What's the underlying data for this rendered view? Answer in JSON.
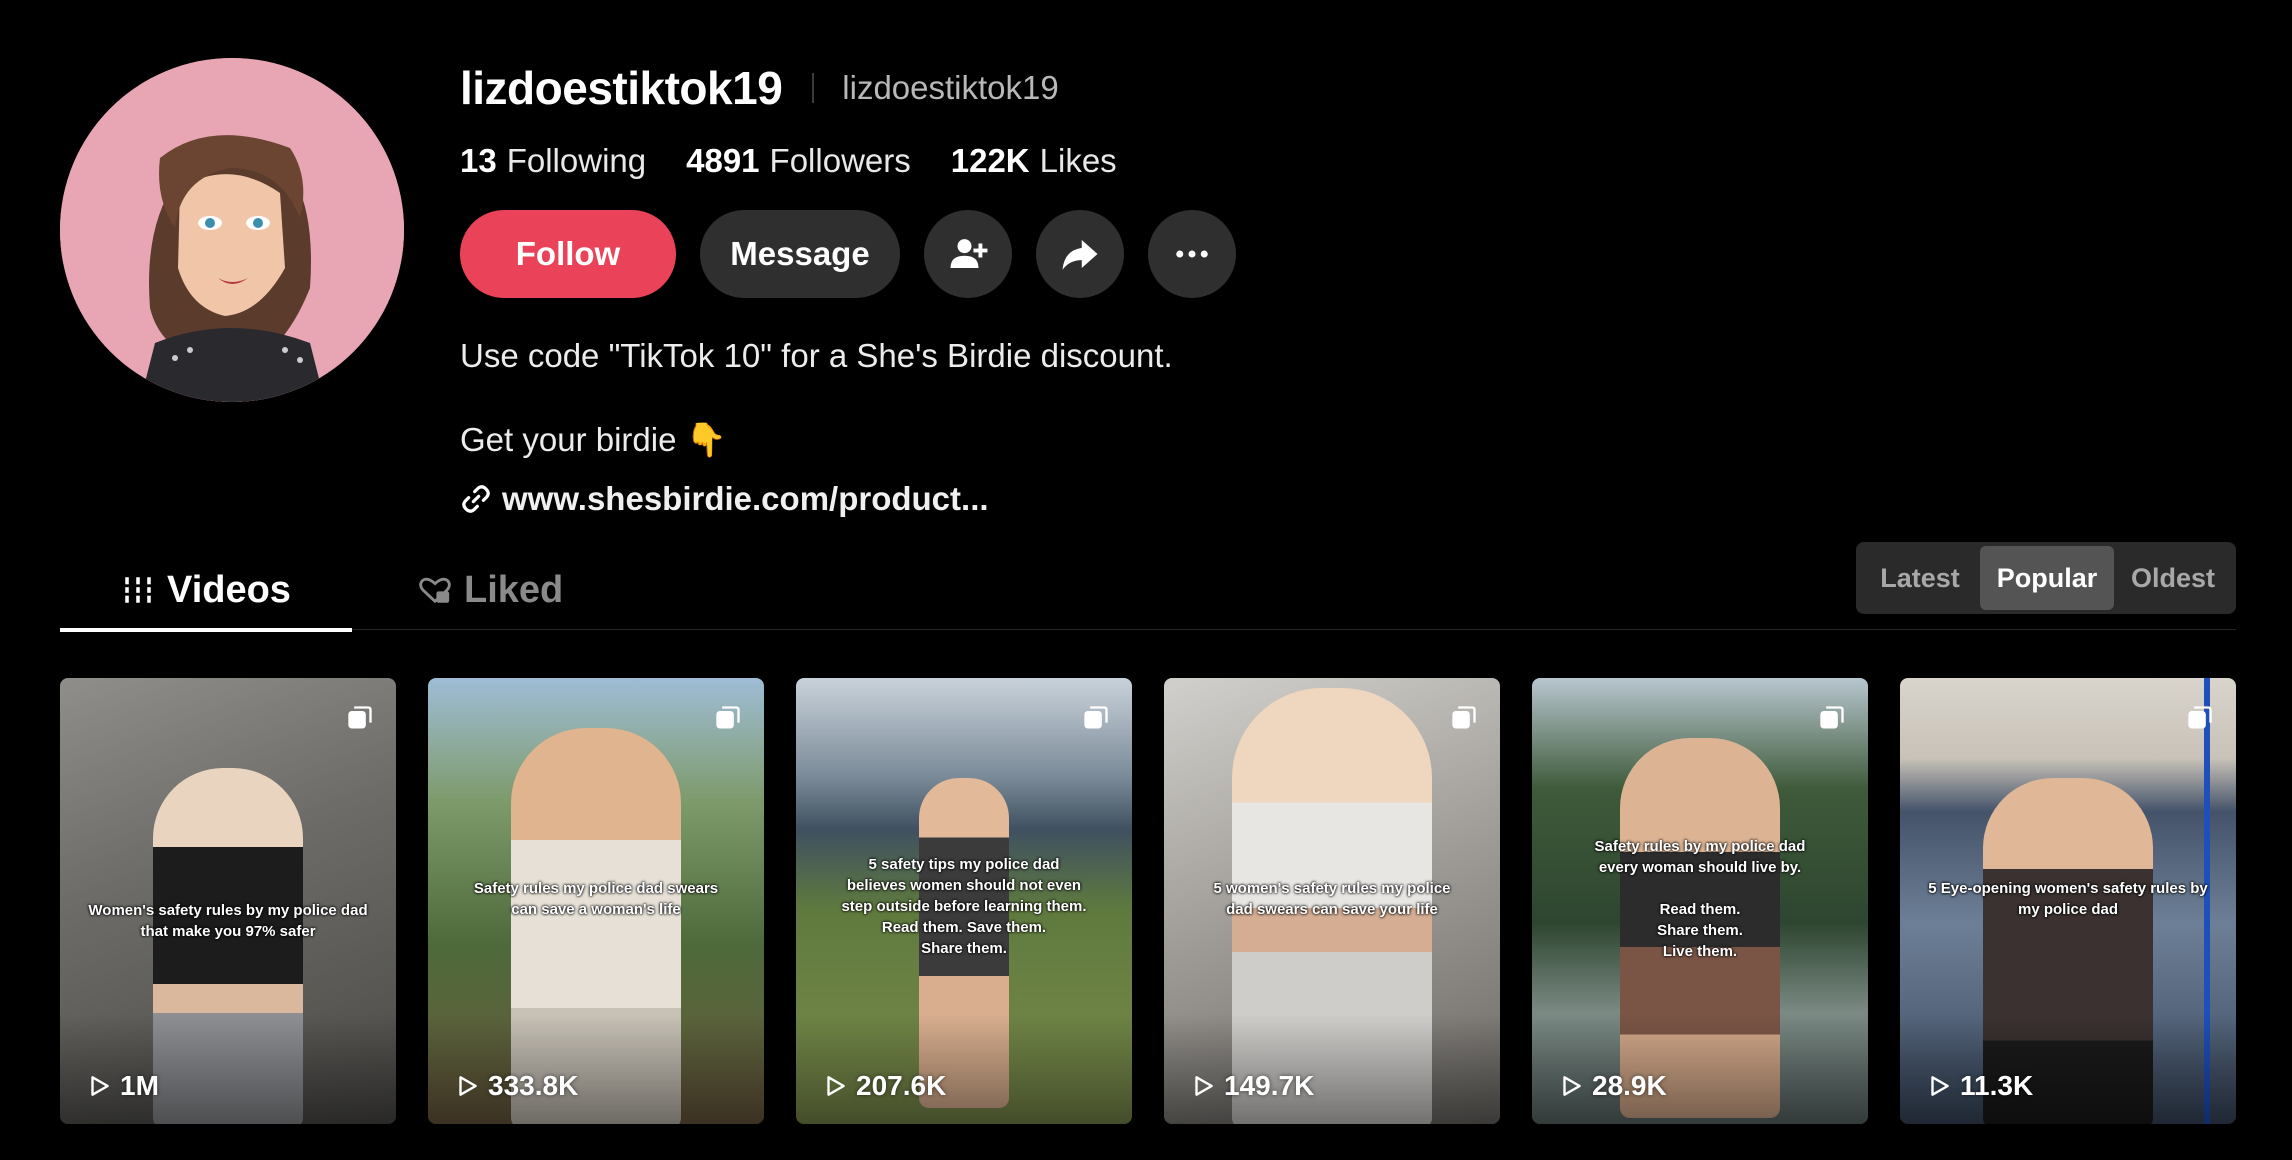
{
  "profile": {
    "username": "lizdoestiktok19",
    "nickname": "lizdoestiktok19",
    "following_count": "13",
    "following_label": "Following",
    "followers_count": "4891",
    "followers_label": "Followers",
    "likes_count": "122K",
    "likes_label": "Likes"
  },
  "actions": {
    "follow_label": "Follow",
    "message_label": "Message",
    "add_friend_icon": "add-person-icon",
    "share_icon": "share-arrow-icon",
    "more_icon": "more-dots-icon"
  },
  "bio": {
    "line1": "Use code \"TikTok 10\" for a She's Birdie discount.",
    "line2": "Get your birdie 👇",
    "link": "www.shesbirdie.com/product..."
  },
  "tabs": {
    "videos_label": "Videos",
    "liked_label": "Liked"
  },
  "sort": {
    "options": [
      "Latest",
      "Popular",
      "Oldest"
    ],
    "selected": "Popular"
  },
  "videos": [
    {
      "caption": "Women's safety rules by my police dad\nthat make you 97% safer",
      "views": "1M"
    },
    {
      "caption": "Safety rules my police dad swears\ncan save a woman's life",
      "views": "333.8K"
    },
    {
      "caption": "5 safety tips my police dad\nbelieves women should not even\nstep outside before learning them.\nRead them.  Save them.\nShare them.",
      "views": "207.6K"
    },
    {
      "caption": "5 women's safety rules my police\ndad swears can save your life",
      "views": "149.7K"
    },
    {
      "caption": "Safety rules by my police dad\nevery woman should live by.\n\nRead them.\nShare them.\nLive them.",
      "views": "28.9K"
    },
    {
      "caption": "5 Eye-opening women's safety rules by\nmy police dad",
      "views": "11.3K"
    }
  ],
  "colors": {
    "background": "#000000",
    "follow_button": "#ea4359",
    "secondary_button": "#2f2f2f",
    "avatar_bg": "#e8a6b4"
  }
}
